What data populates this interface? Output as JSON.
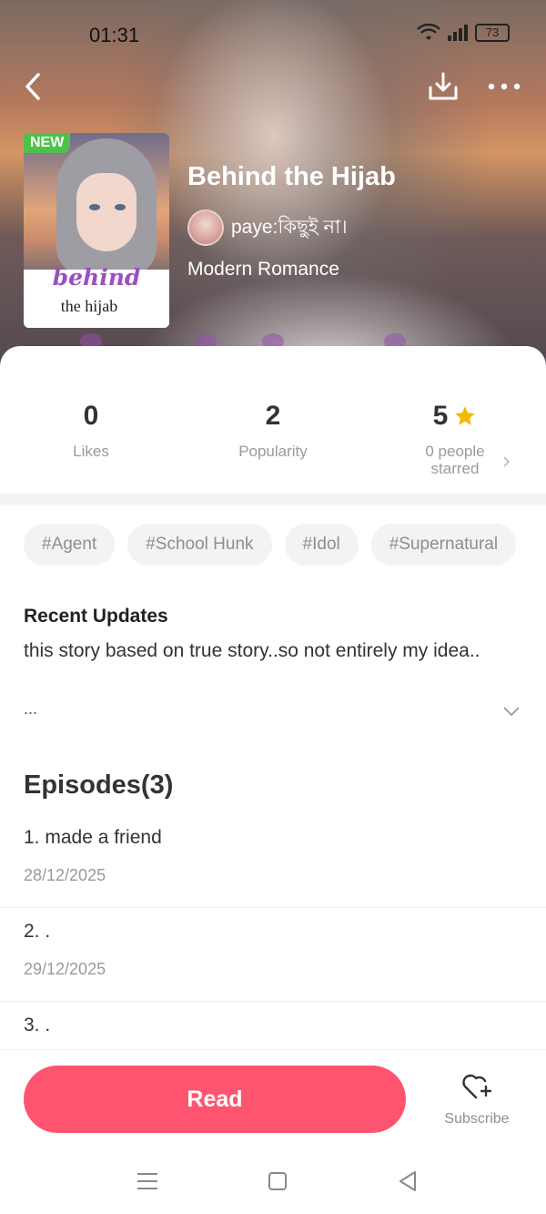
{
  "status_bar": {
    "time": "01:31",
    "battery": "73",
    "icons": [
      "wifi-icon",
      "signal-icon",
      "battery-icon"
    ]
  },
  "nav": {
    "icons": [
      "back-icon",
      "download-icon",
      "more-icon"
    ]
  },
  "book": {
    "badge": "NEW",
    "cover_title": "behind",
    "cover_subtitle": "the hijab",
    "title": "Behind the Hijab",
    "author": "paye:কিছুই না।",
    "genre": "Modern Romance"
  },
  "stats": [
    {
      "value": "0",
      "label": "Likes"
    },
    {
      "value": "2",
      "label": "Popularity"
    },
    {
      "value": "5",
      "label": "0 people starred",
      "icon": "star-icon"
    }
  ],
  "tags": [
    "#Agent",
    "#School Hunk",
    "#Idol",
    "#Supernatural"
  ],
  "recent": {
    "title": "Recent Updates",
    "text": "this story based on true story..so not entirely my idea..",
    "ellipsis": "..."
  },
  "episodes": {
    "title": "Episodes(3)",
    "items": [
      {
        "title": "1. made a friend",
        "date": "28/12/2025"
      },
      {
        "title": "2. .",
        "date": "29/12/2025"
      },
      {
        "title": "3. .",
        "date": ""
      }
    ]
  },
  "actions": {
    "read_label": "Read",
    "subscribe_label": "Subscribe"
  },
  "colors": {
    "accent": "#ff5470",
    "badge": "#4fc14a",
    "star": "#f5b800"
  },
  "system_nav": [
    "menu-icon",
    "home-icon",
    "back-triangle-icon"
  ]
}
